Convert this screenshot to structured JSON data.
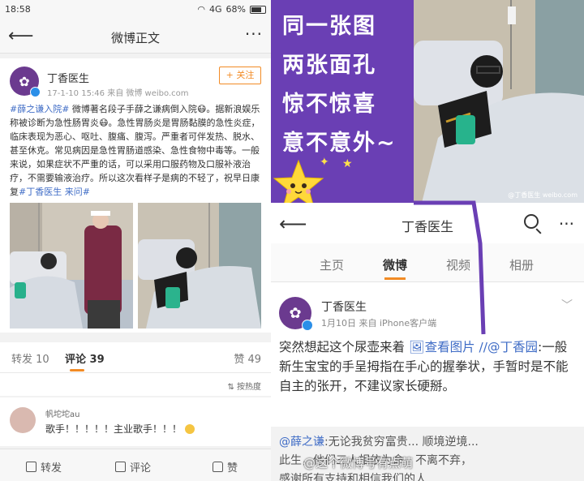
{
  "left": {
    "status": {
      "time": "18:58",
      "network": "4G",
      "battery": "68%"
    },
    "nav": {
      "back_icon": "back-arrow-icon",
      "title": "微博正文",
      "more_icon": "more-icon"
    },
    "post": {
      "user": "丁香医生",
      "meta": "17-1-10 15:46  来自 微博 weibo.com",
      "follow": "+ 关注",
      "text_tag": "#薛之谦入院#",
      "text_body": " 微博著名段子手薛之谦病倒入院😷。据新浪娱乐称被诊断为急性肠胃炎😷。急性胃肠炎是胃肠黏膜的急性炎症，临床表现为恶心、呕吐、腹痛、腹泻。严重者可伴发热、脱水、甚至休克。常见病因是急性胃肠道感染、急性食物中毒等。一般来说，如果症状不严重的话，可以采用口服药物及口服补液治疗，不需要输液治疗。所以这次看样子是病的不轻了，祝早日康复",
      "text_tag2": "#丁香医生 来问#"
    },
    "tabs": {
      "repost": "转发 10",
      "comment": "评论 39",
      "like": "赞 49"
    },
    "sort": "按热度",
    "comment": {
      "name": "帆坨坨au",
      "text": "歌手！！！！！主业歌手！！！"
    },
    "actions": {
      "repost": "转发",
      "comment": "评论",
      "like": "赞"
    }
  },
  "right": {
    "caption": [
      "同一张图",
      "两张面孔",
      "惊不惊喜",
      "意不意外~"
    ],
    "photo_tag": "@丁香医生 weibo.com",
    "nav": {
      "title": "丁香医生"
    },
    "tabs": [
      "主页",
      "微博",
      "视频",
      "相册"
    ],
    "post": {
      "user": "丁香医生",
      "meta": "1月10日  来自 iPhone客户端",
      "text_1": "突然想起这个尿壶来着 ",
      "text_link": "🖼查看图片",
      "text_mention": " //@丁香园",
      "text_2": ":一般新生宝宝的手呈拇指在手心的握拳状，手暂时是不能自主的张开，不建议家长硬掰。"
    },
    "quote": {
      "mention": "@薛之谦",
      "line1": ":无论我贫穷富贵... 顺境逆境...",
      "line2": "此生，他们三人相依为命，不离不弃，",
      "line3": "感谢所有支持和相信我们的人"
    },
    "watermark": "@这个微博号有点萌"
  }
}
